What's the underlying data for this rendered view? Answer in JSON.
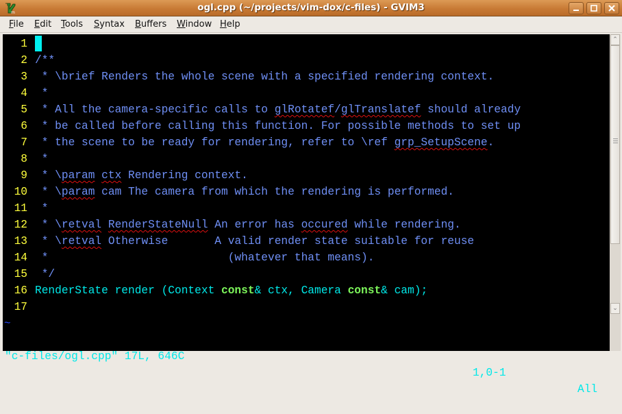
{
  "window": {
    "title": "ogl.cpp (~/projects/vim-dox/c-files) - GVIM3",
    "buttons": [
      "minimize",
      "maximize",
      "close"
    ]
  },
  "menubar": {
    "items": [
      {
        "label": "File",
        "mnemonic": "F"
      },
      {
        "label": "Edit",
        "mnemonic": "E"
      },
      {
        "label": "Tools",
        "mnemonic": "T"
      },
      {
        "label": "Syntax",
        "mnemonic": "S"
      },
      {
        "label": "Buffers",
        "mnemonic": "B"
      },
      {
        "label": "Window",
        "mnemonic": "W"
      },
      {
        "label": "Help",
        "mnemonic": "H"
      }
    ]
  },
  "editor": {
    "colors": {
      "line_number": "#ffff3c",
      "comment": "#6f8ff5",
      "code": "#00e8e8",
      "keyword": "#7cf45a",
      "cursor": "#00f0f0",
      "spell_error": "#e01010",
      "background": "#000000"
    },
    "lines": [
      {
        "n": "1",
        "segments": []
      },
      {
        "n": "2",
        "segments": [
          {
            "t": "/**",
            "c": "cm"
          }
        ]
      },
      {
        "n": "3",
        "segments": [
          {
            "t": " * \\brief Renders the whole scene with a specified rendering context.",
            "c": "cm"
          }
        ]
      },
      {
        "n": "4",
        "segments": [
          {
            "t": " *",
            "c": "cm"
          }
        ]
      },
      {
        "n": "5",
        "segments": [
          {
            "t": " * All the camera-specific calls to ",
            "c": "cm"
          },
          {
            "t": "glRotatef",
            "c": "cm sp"
          },
          {
            "t": "/",
            "c": "cm"
          },
          {
            "t": "glTranslatef",
            "c": "cm sp"
          },
          {
            "t": " should already",
            "c": "cm"
          }
        ]
      },
      {
        "n": "6",
        "segments": [
          {
            "t": " * be called before calling this function. For possible methods to set up",
            "c": "cm"
          }
        ]
      },
      {
        "n": "7",
        "segments": [
          {
            "t": " * the scene to be ready for rendering, refer to \\ref ",
            "c": "cm"
          },
          {
            "t": "grp_SetupScene",
            "c": "cm sp"
          },
          {
            "t": ".",
            "c": "cm"
          }
        ]
      },
      {
        "n": "8",
        "segments": [
          {
            "t": " *",
            "c": "cm"
          }
        ]
      },
      {
        "n": "9",
        "segments": [
          {
            "t": " * \\",
            "c": "cm"
          },
          {
            "t": "param",
            "c": "cm sp"
          },
          {
            "t": " ",
            "c": "cm"
          },
          {
            "t": "ctx",
            "c": "cm sp"
          },
          {
            "t": " Rendering context.",
            "c": "cm"
          }
        ]
      },
      {
        "n": "10",
        "segments": [
          {
            "t": " * \\",
            "c": "cm"
          },
          {
            "t": "param",
            "c": "cm sp"
          },
          {
            "t": " cam The camera from which the rendering is performed.",
            "c": "cm"
          }
        ]
      },
      {
        "n": "11",
        "segments": [
          {
            "t": " *",
            "c": "cm"
          }
        ]
      },
      {
        "n": "12",
        "segments": [
          {
            "t": " * \\",
            "c": "cm"
          },
          {
            "t": "retval",
            "c": "cm sp"
          },
          {
            "t": " ",
            "c": "cm"
          },
          {
            "t": "RenderStateNull",
            "c": "cm sp"
          },
          {
            "t": " An error has ",
            "c": "cm"
          },
          {
            "t": "occured",
            "c": "cm sp"
          },
          {
            "t": " while rendering.",
            "c": "cm"
          }
        ]
      },
      {
        "n": "13",
        "segments": [
          {
            "t": " * \\",
            "c": "cm"
          },
          {
            "t": "retval",
            "c": "cm sp"
          },
          {
            "t": " Otherwise       A valid render state suitable for reuse",
            "c": "cm"
          }
        ]
      },
      {
        "n": "14",
        "segments": [
          {
            "t": " *                           (whatever that means).",
            "c": "cm"
          }
        ]
      },
      {
        "n": "15",
        "segments": [
          {
            "t": " */",
            "c": "cm"
          }
        ]
      },
      {
        "n": "16",
        "segments": [
          {
            "t": "RenderState render (Context ",
            "c": "ty"
          },
          {
            "t": "const",
            "c": "kw"
          },
          {
            "t": "& ctx, Camera ",
            "c": "ty"
          },
          {
            "t": "const",
            "c": "kw"
          },
          {
            "t": "& cam);",
            "c": "ty"
          }
        ]
      },
      {
        "n": "17",
        "segments": []
      }
    ],
    "tilde": "~",
    "cursor_line": 1
  },
  "status": {
    "message": "\"c-files/ogl.cpp\" 17L, 646C",
    "position": "1,0-1",
    "scroll": "All"
  }
}
